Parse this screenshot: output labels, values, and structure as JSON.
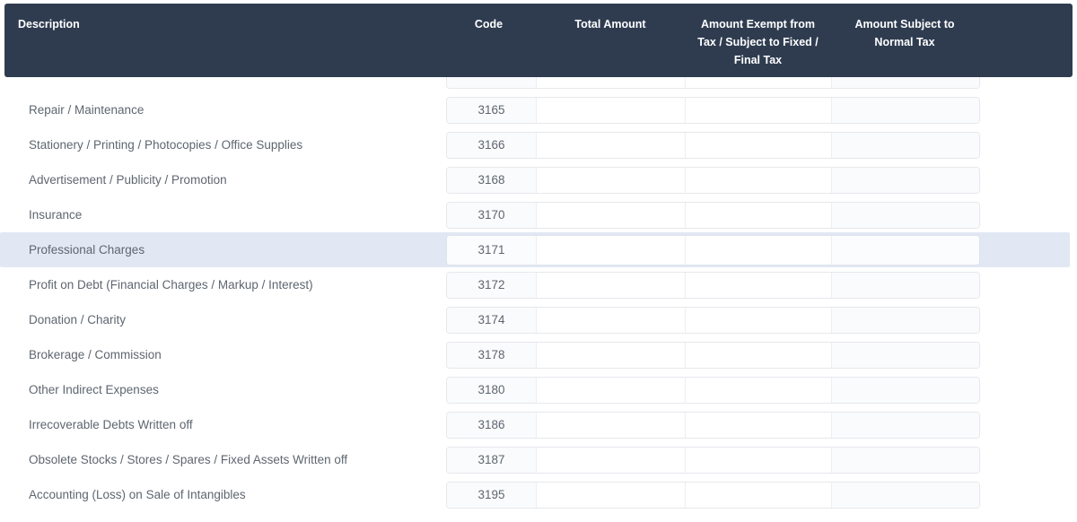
{
  "table": {
    "columns": [
      {
        "key": "description",
        "label": "Description"
      },
      {
        "key": "code",
        "label": "Code"
      },
      {
        "key": "total_amount",
        "label": "Total Amount"
      },
      {
        "key": "amount_exempt",
        "label": "Amount Exempt from Tax / Subject to Fixed / Final Tax"
      },
      {
        "key": "amount_normal",
        "label": "Amount Subject to Normal Tax"
      }
    ],
    "header": {
      "description": "Description",
      "code": "Code",
      "total_amount": "Total Amount",
      "amount_exempt_line1": "Amount Exempt from",
      "amount_exempt_line2": "Tax / Subject to Fixed /",
      "amount_exempt_line3": "Final Tax",
      "amount_normal_line1": "Amount Subject to",
      "amount_normal_line2": "Normal Tax"
    },
    "colors": {
      "header_background": "#2f3c50",
      "header_text": "#ffffff",
      "row_highlight": "#e1e8f4",
      "label_text": "#5e6670",
      "input_disabled_background": "#fafbfc",
      "input_background": "#ffffff",
      "input_border": "#e6e8ec"
    },
    "rows": [
      {
        "description": "",
        "code": "",
        "total_amount": "",
        "amount_exempt": "",
        "amount_normal": "",
        "clipped": true,
        "highlighted": false
      },
      {
        "description": "Repair / Maintenance",
        "code": "3165",
        "total_amount": "",
        "amount_exempt": "",
        "amount_normal": "",
        "highlighted": false
      },
      {
        "description": "Stationery / Printing / Photocopies / Office Supplies",
        "code": "3166",
        "total_amount": "",
        "amount_exempt": "",
        "amount_normal": "",
        "highlighted": false
      },
      {
        "description": "Advertisement / Publicity / Promotion",
        "code": "3168",
        "total_amount": "",
        "amount_exempt": "",
        "amount_normal": "",
        "highlighted": false
      },
      {
        "description": "Insurance",
        "code": "3170",
        "total_amount": "",
        "amount_exempt": "",
        "amount_normal": "",
        "highlighted": false
      },
      {
        "description": "Professional Charges",
        "code": "3171",
        "total_amount": "",
        "amount_exempt": "",
        "amount_normal": "",
        "highlighted": true
      },
      {
        "description": "Profit on Debt (Financial Charges / Markup / Interest)",
        "code": "3172",
        "total_amount": "",
        "amount_exempt": "",
        "amount_normal": "",
        "highlighted": false
      },
      {
        "description": "Donation / Charity",
        "code": "3174",
        "total_amount": "",
        "amount_exempt": "",
        "amount_normal": "",
        "highlighted": false
      },
      {
        "description": "Brokerage / Commission",
        "code": "3178",
        "total_amount": "",
        "amount_exempt": "",
        "amount_normal": "",
        "highlighted": false
      },
      {
        "description": "Other Indirect Expenses",
        "code": "3180",
        "total_amount": "",
        "amount_exempt": "",
        "amount_normal": "",
        "highlighted": false
      },
      {
        "description": "Irrecoverable Debts Written off",
        "code": "3186",
        "total_amount": "",
        "amount_exempt": "",
        "amount_normal": "",
        "highlighted": false
      },
      {
        "description": "Obsolete Stocks / Stores / Spares / Fixed Assets Written off",
        "code": "3187",
        "total_amount": "",
        "amount_exempt": "",
        "amount_normal": "",
        "highlighted": false
      },
      {
        "description": "Accounting (Loss) on Sale of Intangibles",
        "code": "3195",
        "total_amount": "",
        "amount_exempt": "",
        "amount_normal": "",
        "highlighted": false
      }
    ]
  }
}
